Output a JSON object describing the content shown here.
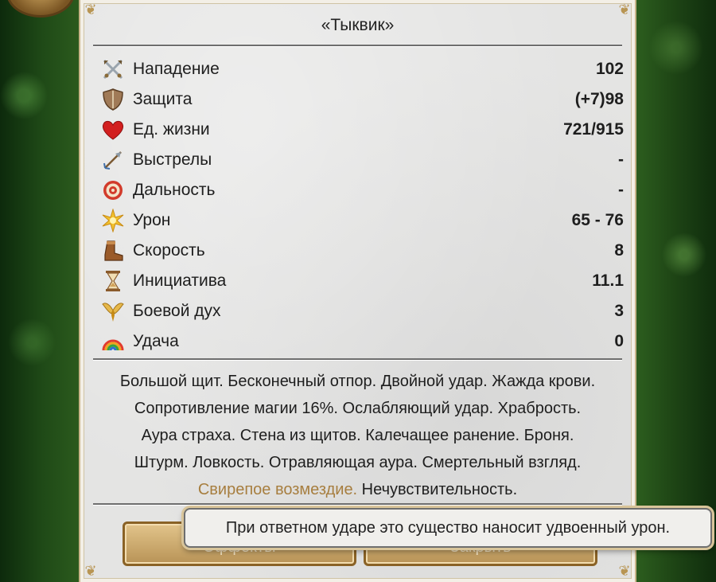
{
  "window": {
    "title": "«Тыквик»"
  },
  "stats": [
    {
      "icon": "crossed-swords-icon",
      "label": "Нападение",
      "value": "102"
    },
    {
      "icon": "shield-icon",
      "label": "Защита",
      "value": "(+7)98"
    },
    {
      "icon": "heart-icon",
      "label": "Ед. жизни",
      "value": "721/915"
    },
    {
      "icon": "arrow-icon",
      "label": "Выстрелы",
      "value": "-"
    },
    {
      "icon": "target-icon",
      "label": "Дальность",
      "value": "-"
    },
    {
      "icon": "burst-icon",
      "label": "Урон",
      "value": "65 - 76"
    },
    {
      "icon": "boot-icon",
      "label": "Скорость",
      "value": "8"
    },
    {
      "icon": "hourglass-icon",
      "label": "Инициатива",
      "value": "11.1"
    },
    {
      "icon": "wings-icon",
      "label": "Боевой дух",
      "value": "3"
    },
    {
      "icon": "rainbow-icon",
      "label": "Удача",
      "value": "0"
    }
  ],
  "abilities": {
    "line1": "Большой щит. Бесконечный отпор. Двойной удар. Жажда крови.",
    "line2": "Сопротивление магии 16%. Ослабляющий удар. Храбрость.",
    "line3": "Аура страха. Стена из щитов. Калечащее ранение. Броня.",
    "line4": "Штурм. Ловкость. Отравляющая аура. Смертельный взгляд.",
    "highlight": "Свирепое возмездие.",
    "line5_rest": " Нечувствительность."
  },
  "buttons": {
    "effects": "Эффекты",
    "close": "Закрыть"
  },
  "tooltip": {
    "text": "При ответном ударе это существо наносит удвоенный урон."
  },
  "colors": {
    "highlight": "#a77e3f",
    "button": "#c9a66a",
    "panel": "#e4e4e3"
  }
}
